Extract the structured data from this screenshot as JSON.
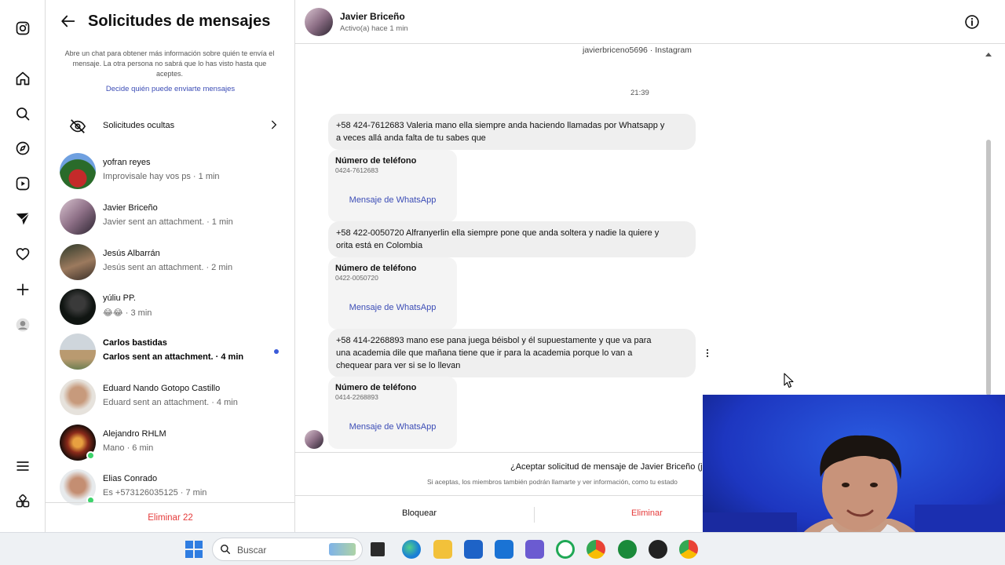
{
  "panel": {
    "title": "Solicitudes de mensajes",
    "info_text": "Abre un chat para obtener más información sobre quién te envía el mensaje. La otra persona no sabrá que lo has visto hasta que aceptes.",
    "decide_link": "Decide quién puede enviarte mensajes",
    "hidden_requests": "Solicitudes ocultas",
    "conversations": [
      {
        "name": "yofran reyes",
        "preview": "Improvisale hay vos ps · 1 min",
        "unread": false,
        "online": false
      },
      {
        "name": "Javier Briceño",
        "preview": "Javier sent an attachment. · 1 min",
        "unread": false,
        "online": false
      },
      {
        "name": "Jesús Albarrán",
        "preview": "Jesús sent an attachment. · 2 min",
        "unread": false,
        "online": false
      },
      {
        "name": "yúliu PP.",
        "preview": "😂😂 · 3 min",
        "unread": false,
        "online": false
      },
      {
        "name": "Carlos bastidas",
        "preview": "Carlos sent an attachment. · 4 min",
        "unread": true,
        "online": false
      },
      {
        "name": "Eduard Nando Gotopo Castillo",
        "preview": "Eduard sent an attachment. · 4 min",
        "unread": false,
        "online": false
      },
      {
        "name": "Alejandro RHLM",
        "preview": "Mano · 6 min",
        "unread": false,
        "online": true
      },
      {
        "name": "Elias Conrado",
        "preview": "Es +573126035125 · 7 min",
        "unread": false,
        "online": true
      }
    ],
    "delete_all": "Eliminar 22"
  },
  "chat": {
    "name": "Javier Briceño",
    "status": "Activo(a) hace 1 min",
    "handle": "javierbriceno5696 · Instagram",
    "time": "21:39",
    "messages": [
      {
        "text1": "+58 424-7612683 Valeria mano ella siempre anda haciendo llamadas por Whatsapp y",
        "text2": "a veces allá anda falta de tu sabes que",
        "text3": "",
        "card_title": "Número de teléfono",
        "card_number": "0424-7612683",
        "card_action": "Mensaje de WhatsApp"
      },
      {
        "text1": "+58 422-0050720 Alfranyerlin ella siempre pone que anda soltera y nadie la quiere y",
        "text2": "orita está en Colombia",
        "text3": "",
        "card_title": "Número de teléfono",
        "card_number": "0422-0050720",
        "card_action": "Mensaje de WhatsApp"
      },
      {
        "text1": "+58 414-2268893 mano ese pana juega béisbol y él supuestamente y que va para",
        "text2": "una academia dile que mañana tiene que ir para la academia porque lo van a",
        "text3": "chequear para ver si se lo llevan",
        "card_title": "Número de teléfono",
        "card_number": "0414-2268893",
        "card_action": "Mensaje de WhatsApp"
      }
    ],
    "request_question": "¿Aceptar solicitud de mensaje de Javier Briceño (j",
    "request_sub": "Si aceptas, los miembros también podrán llamarte y ver información, como tu estado",
    "block_label": "Bloquear",
    "delete_label": "Eliminar"
  },
  "taskbar": {
    "search_placeholder": "Buscar"
  }
}
